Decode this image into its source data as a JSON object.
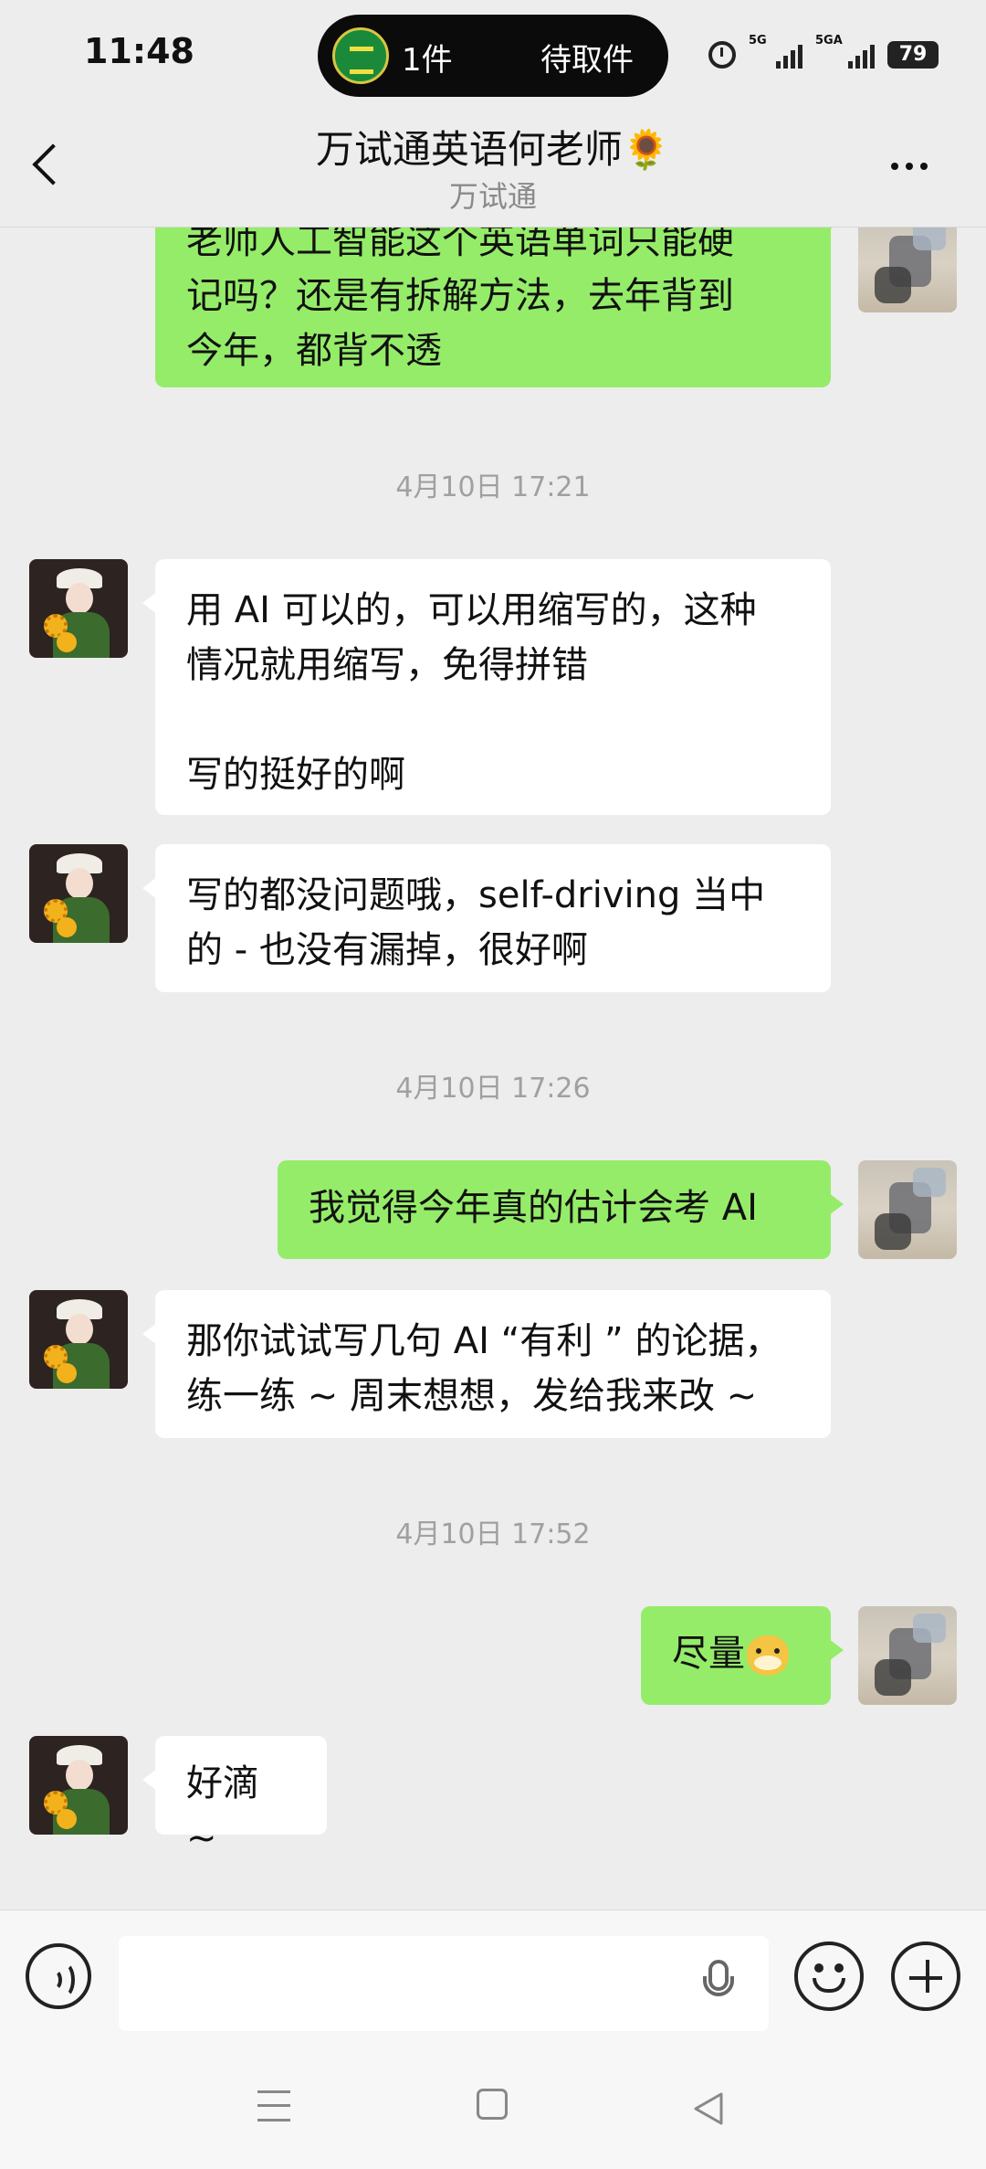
{
  "status_bar": {
    "time": "11:48",
    "pill": {
      "count": "1件",
      "status": "待取件"
    },
    "signal1": "5G",
    "signal2": "5GA",
    "battery": "79"
  },
  "header": {
    "title": "万试通英语何老师🌻",
    "subtitle": "万试通"
  },
  "messages": [
    {
      "lines": [
        "老师人工智能这个英语单词只能硬",
        "记吗？还是有拆解方法，去年背到",
        "今年，都背不透"
      ]
    },
    {
      "timestamp": "4月10日 17:21"
    },
    {
      "paragraphs": [
        "用 AI 可以的，可以用缩写的，这种",
        "情况就用缩写，免得拼错"
      ],
      "paragraph2": "写的挺好的啊"
    },
    {
      "lines": [
        "写的都没问题哦，self-driving 当中",
        "的 - 也没有漏掉，很好啊"
      ]
    },
    {
      "timestamp": "4月10日 17:26"
    },
    {
      "text": "我觉得今年真的估计会考 AI"
    },
    {
      "lines": [
        "那你试试写几句 AI “有利 ” 的论据，",
        "练一练 ~ 周末想想，发给我来改 ~"
      ]
    },
    {
      "timestamp": "4月10日 17:52"
    },
    {
      "text": "尽量"
    },
    {
      "text": "好滴 ~"
    }
  ],
  "input_bar": {
    "placeholder": ""
  },
  "icons": {
    "back": "chevron-left-icon",
    "more": "more-dots-icon",
    "voice": "voice-icon",
    "mic": "microphone-icon",
    "emoji": "emoji-icon",
    "plus": "plus-icon"
  },
  "colors": {
    "outgoing_bubble": "#95ec69",
    "incoming_bubble": "#ffffff",
    "background": "#ededed"
  }
}
